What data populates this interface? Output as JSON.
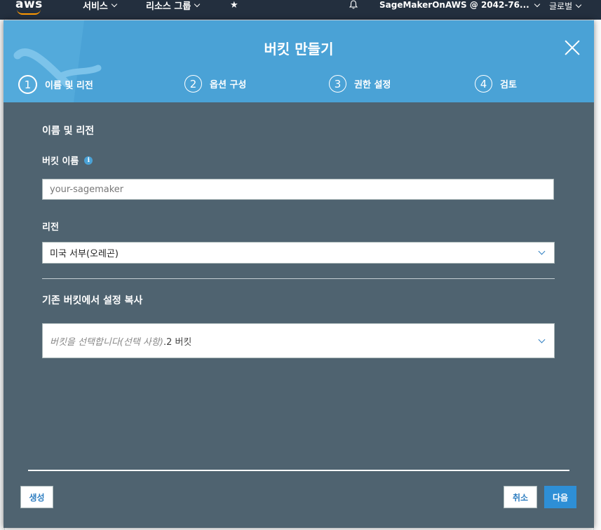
{
  "topnav": {
    "logo": "aws",
    "services_label": "서비스",
    "resource_groups_label": "리소스 그룹",
    "pin_icon": "pin-icon",
    "bell_icon": "bell-icon",
    "account_label": "SageMakerOnAWS @ 2042-76...",
    "region_label": "글로벌"
  },
  "modal": {
    "title": "버킷 만들기",
    "steps": [
      {
        "number": "1",
        "label": "이름 및 리전",
        "active": true
      },
      {
        "number": "2",
        "label": "옵션 구성",
        "active": false
      },
      {
        "number": "3",
        "label": "권한 설정",
        "active": false
      },
      {
        "number": "4",
        "label": "검토",
        "active": false
      }
    ],
    "section_title": "이름 및 리전",
    "bucket_name_label": "버킷 이름",
    "bucket_name_value": "",
    "bucket_name_placeholder": "your-sagemaker",
    "region_label": "리전",
    "region_value": "미국 서부(오레곤)",
    "copy_section_title": "기존 버킷에서 설정 복사",
    "copy_select_placeholder": "버킷을 선택합니다(선택 사항)",
    "copy_select_count": ".2 버킷",
    "buttons": {
      "create": "생성",
      "cancel": "취소",
      "next": "다음"
    }
  },
  "colors": {
    "header_blue": "#4aa2d6",
    "modal_body": "#4f6370",
    "nav_dark": "#232f3e",
    "accent_orange": "#ff9900",
    "primary_button": "#2e8fd6"
  }
}
